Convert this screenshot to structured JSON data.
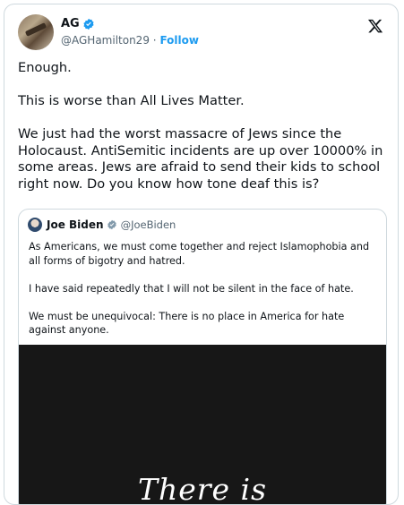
{
  "author": {
    "display_name": "AG",
    "handle": "@AGHamilton29",
    "separator": "·",
    "follow_label": "Follow",
    "verified_icon": "verified-badge-icon"
  },
  "brand": {
    "logo": "x-logo-icon"
  },
  "tweet": {
    "paragraphs": [
      "Enough.",
      "This is worse than All Lives Matter.",
      "We just had the worst massacre of Jews since the Holocaust. AntiSemitic incidents are up over 10000% in some areas. Jews are afraid to send their kids to school right now. Do you know how tone deaf this is?"
    ]
  },
  "quoted_tweet": {
    "display_name": "Joe Biden",
    "handle": "@JoeBiden",
    "paragraphs": [
      "As Americans, we must come together and reject Islamophobia and all forms of bigotry and hatred.",
      "I have said repeatedly that I will not be silent in the face of hate.",
      "We must be unequivocal: There is no place in America for hate against anyone."
    ],
    "image_text": "There is"
  },
  "colors": {
    "accent": "#1d9bf0",
    "text": "#0f1419",
    "secondary_text": "#536471",
    "border": "#cfd9de",
    "image_bg": "#171717"
  }
}
